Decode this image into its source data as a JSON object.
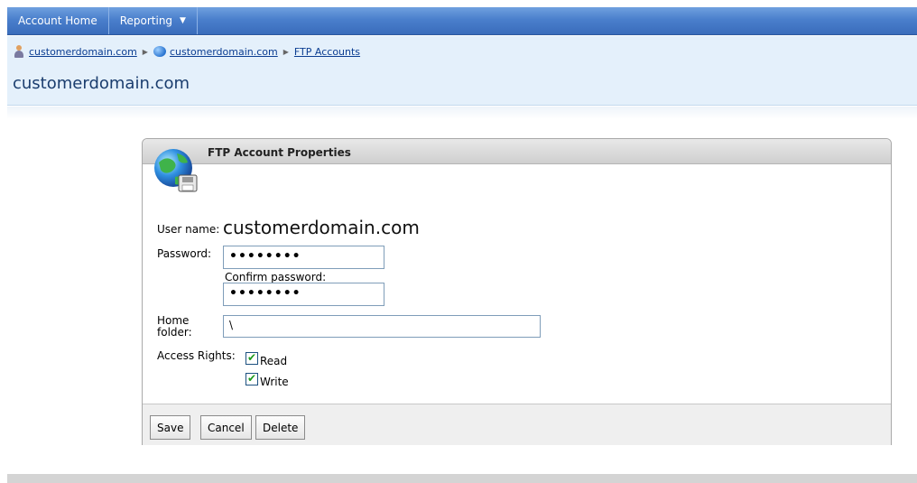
{
  "nav": {
    "items": [
      {
        "label": "Account Home"
      },
      {
        "label": "Reporting",
        "caret": "▼"
      }
    ]
  },
  "breadcrumb": {
    "items": [
      {
        "label": "customerdomain.com",
        "icon": "user-icon"
      },
      {
        "label": "customerdomain.com",
        "icon": "globe-icon"
      },
      {
        "label": "FTP Accounts"
      }
    ],
    "separator": "▶"
  },
  "page": {
    "title": "customerdomain.com"
  },
  "panel": {
    "title": "FTP Account Properties",
    "icon": "ftp-globe-icon"
  },
  "form": {
    "username_label": "User name:",
    "username_value": "customerdomain.com",
    "password_label": "Password:",
    "password_value": "••••••••",
    "confirm_label": "Confirm password:",
    "confirm_value": "••••••••",
    "home_folder_label_1": "Home",
    "home_folder_label_2": "folder:",
    "home_folder_value": "\\",
    "access_rights_label": "Access Rights:",
    "read_label": "Read",
    "read_checked": true,
    "write_label": "Write",
    "write_checked": true
  },
  "buttons": {
    "save": "Save",
    "cancel": "Cancel",
    "delete": "Delete"
  },
  "colors": {
    "nav_bar": "#4a7fcc",
    "header_bg": "#e4f0fb",
    "title_color": "#1a3d6e",
    "link_color": "#0b3d91",
    "check_color": "#1d9b1d"
  }
}
